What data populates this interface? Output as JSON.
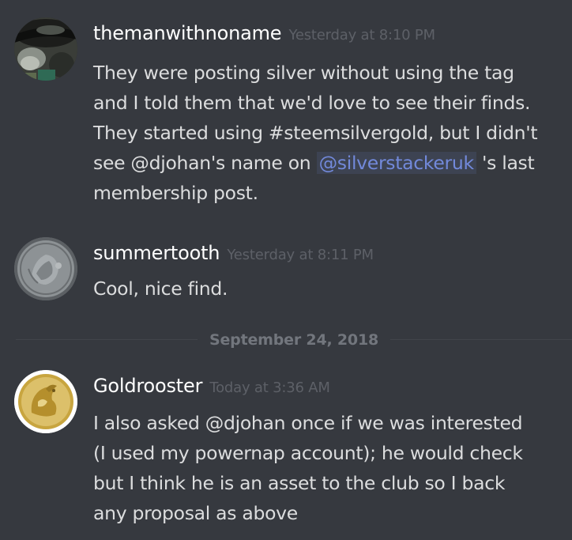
{
  "messages": [
    {
      "username": "themanwithnoname",
      "timestamp": "Yesterday at 8:10 PM",
      "body_lines": [
        "They were posting silver without using the tag",
        "and I told them that we'd love to see their finds.",
        "They started using #steemsilvergold, but I didn't",
        "see @djohan's name on ",
        "membership post."
      ],
      "mention": "@silverstackeruk",
      "after_mention": " 's last",
      "avatar_icon": "user-avatar-hat"
    },
    {
      "username": "summertooth",
      "timestamp": "Yesterday at 8:11 PM",
      "body_lines": [
        "Cool, nice find."
      ],
      "avatar_icon": "silver-coin-avatar"
    },
    {
      "username": "Goldrooster",
      "timestamp": "Today at 3:36 AM",
      "body_lines": [
        "I also asked @djohan once if we was interested",
        "(I used my powernap account); he would check",
        "but I think he is an asset to the club so I back",
        "any proposal as above"
      ],
      "avatar_icon": "gold-coin-avatar"
    }
  ],
  "divider": {
    "date_label": "September 24, 2018"
  },
  "colors": {
    "background": "#36393f",
    "username": "#ffffff",
    "timestamp": "#5d6067",
    "body_text": "#dcddde",
    "mention": "#7289da",
    "divider_text": "#72767d"
  }
}
